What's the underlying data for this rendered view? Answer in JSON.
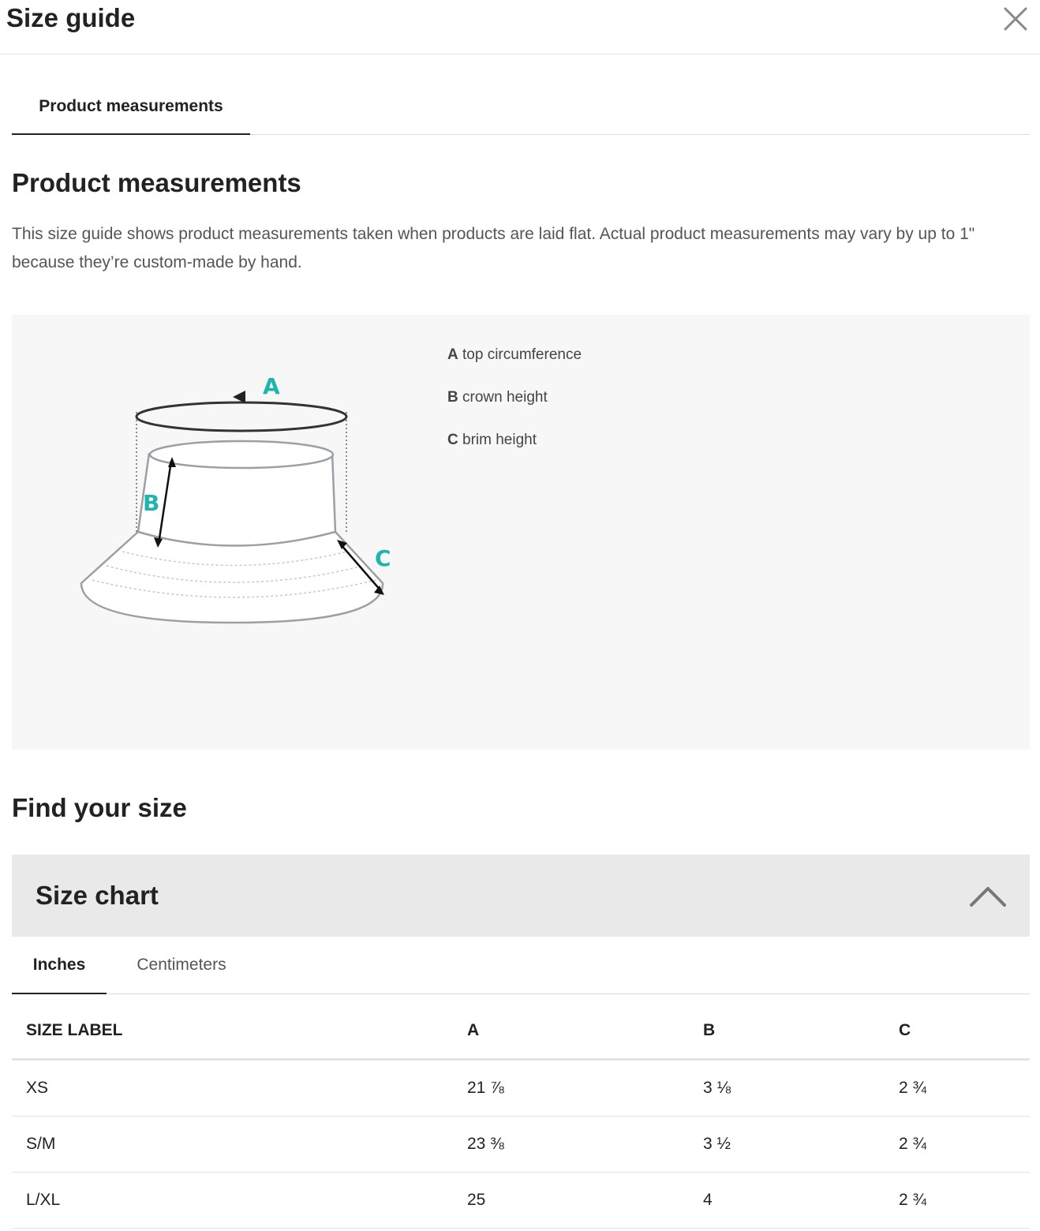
{
  "header": {
    "title": "Size guide",
    "close_icon": "close-icon"
  },
  "top_tabs": [
    {
      "label": "Product measurements",
      "active": true
    }
  ],
  "product_measurements": {
    "heading": "Product measurements",
    "description": "This size guide shows product measurements taken when products are laid flat. Actual product measurements may vary by up to 1\" because they’re custom-made by hand.",
    "diagram": {
      "labels": [
        "A",
        "B",
        "C"
      ],
      "accent_color": "#1fb5ad"
    },
    "legend": [
      {
        "letter": "A",
        "text": " top circumference"
      },
      {
        "letter": "B",
        "text": " crown height"
      },
      {
        "letter": "C",
        "text": " brim height"
      }
    ]
  },
  "find_size": {
    "heading": "Find your size"
  },
  "size_chart": {
    "title": "Size chart",
    "expanded": true,
    "toggle_icon": "chevron-up-icon",
    "unit_tabs": [
      {
        "label": "Inches",
        "active": true
      },
      {
        "label": "Centimeters",
        "active": false
      }
    ],
    "columns": [
      "SIZE LABEL",
      "A",
      "B",
      "C"
    ],
    "rows": [
      [
        "XS",
        "21 ⅞",
        "3 ⅛",
        "2 ¾"
      ],
      [
        "S/M",
        "23 ⅜",
        "3 ½",
        "2 ¾"
      ],
      [
        "L/XL",
        "25",
        "4",
        "2 ¾"
      ]
    ]
  }
}
